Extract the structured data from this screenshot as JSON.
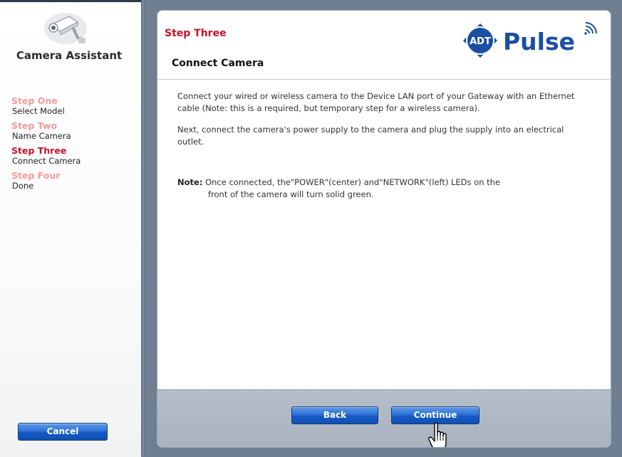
{
  "sidebar": {
    "title": "Camera Assistant",
    "steps": [
      {
        "title": "Step One",
        "subtitle": "Select Model",
        "active": false
      },
      {
        "title": "Step Two",
        "subtitle": "Name Camera",
        "active": false
      },
      {
        "title": "Step Three",
        "subtitle": "Connect Camera",
        "active": true
      },
      {
        "title": "Step Four",
        "subtitle": "Done",
        "active": false
      }
    ],
    "cancel_label": "Cancel"
  },
  "header": {
    "step_label": "Step Three",
    "page_title": "Connect Camera",
    "logo_badge": "ADT",
    "logo_name": "Pulse"
  },
  "content": {
    "paragraph1": "Connect your wired or wireless camera to the Device LAN port of your Gateway with an Ethernet cable (Note: this is a required, but temporary step for a wireless camera).",
    "paragraph2": "Next, connect the camera's power supply to the camera and plug the supply into an electrical outlet.",
    "note_label": "Note:",
    "note_line1": "Once connected, the\"POWER\"(center) and\"NETWORK\"(left) LEDs on the",
    "note_line2": "front of the camera will turn solid green."
  },
  "footer": {
    "back_label": "Back",
    "continue_label": "Continue"
  },
  "colors": {
    "active_step": "#c8102e",
    "inactive_step": "#f39a9c",
    "button_blue": "#1f62cc",
    "brand_blue": "#1a4fa3",
    "background": "#6f7f91"
  },
  "icons": [
    "camera-icon",
    "adt-logo",
    "hand-cursor-icon"
  ]
}
